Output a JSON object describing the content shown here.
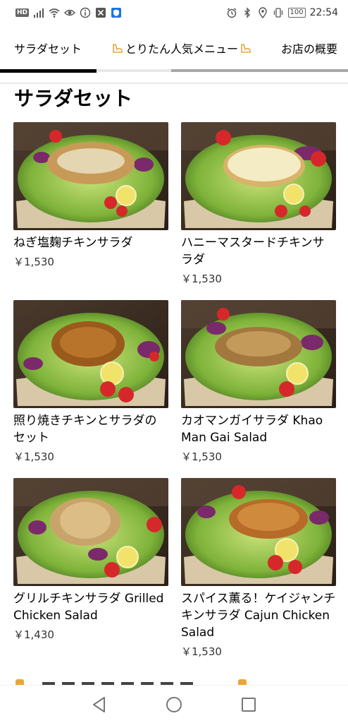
{
  "status_bar": {
    "hd_label": "HD",
    "battery": "100",
    "time": "22:54",
    "icons_left": [
      "signal-icon",
      "wifi-icon",
      "eye-icon",
      "info-icon",
      "app-x-icon",
      "app-shield-icon"
    ],
    "icons_right": [
      "alarm-icon",
      "bluetooth-icon",
      "location-icon",
      "vibrate-icon",
      "battery-icon"
    ]
  },
  "tabs": {
    "items": [
      {
        "label": "サラダセット",
        "active": true
      },
      {
        "label": "とりたん人気メニュー",
        "active": false
      },
      {
        "label": "お店の概要",
        "active": false
      }
    ],
    "emoji_icon": "flexed-arm-icon"
  },
  "section": {
    "title": "サラダセット"
  },
  "menu_items": [
    {
      "name": "ねぎ塩麹チキンサラダ",
      "price": "￥1,530"
    },
    {
      "name": "ハニーマスタードチキンサラダ",
      "price": "￥1,530"
    },
    {
      "name": "照り焼きチキンとサラダのセット",
      "price": "￥1,530"
    },
    {
      "name": "カオマンガイサラダ Khao Man Gai Salad",
      "price": "￥1,530"
    },
    {
      "name": "グリルチキンサラダ Grilled Chicken Salad",
      "price": "￥1,430"
    },
    {
      "name": "スパイス薫る！ケイジャンチキンサラダ Cajun Chicken Salad",
      "price": "￥1,530"
    }
  ],
  "colors": {
    "accent_active_tab": "#000000",
    "tab_emoji": "#e8a63a"
  },
  "navbar": {
    "icons": [
      "back-icon",
      "home-icon",
      "recent-apps-icon"
    ]
  }
}
